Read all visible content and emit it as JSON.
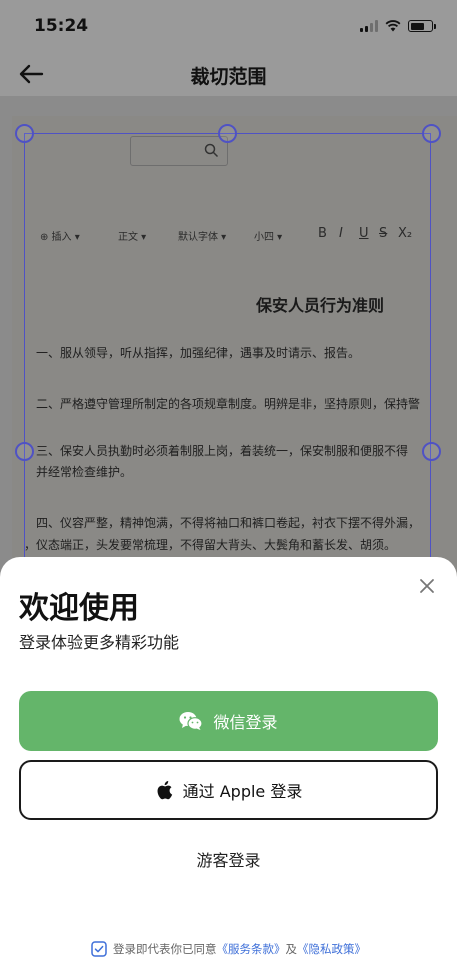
{
  "status_bar": {
    "time": "15:24"
  },
  "nav": {
    "title": "裁切范围"
  },
  "document": {
    "toolbar": [
      "⊕ 插入 ▾",
      "正文 ▾",
      "默认字体 ▾",
      "小四 ▾",
      "B",
      "I",
      "U",
      "S",
      "X₂"
    ],
    "title": "保安人员行为准则",
    "lines": [
      "一、服从领导，听从指挥，加强纪律，遇事及时请示、报告。",
      "二、严格遵守管理所制定的各项规章制度。明辨是非，坚持原则，保持警",
      "三、保安人员执勤时必须着制服上岗，着装统一，保安制服和便服不得",
      "并经常检查维护。",
      "四、仪容严整，精神饱满，不得将袖口和裤口卷起，衬衣下摆不得外漏，",
      "，仪态端正，头发要常梳理，不得留大背头、大鬓角和蓄长发、胡须。"
    ]
  },
  "sheet": {
    "title": "欢迎使用",
    "subtitle": "登录体验更多精彩功能",
    "wechat_label": "微信登录",
    "apple_label": "通过 Apple 登录",
    "guest_label": "游客登录",
    "agree_prefix": "登录即代表你已同意",
    "terms_link": "《服务条款》",
    "and_text": "及",
    "privacy_link": "《隐私政策》"
  },
  "colors": {
    "accent": "#4f52c4",
    "wechat_green": "#64b56a",
    "link_blue": "#3e6fd8"
  }
}
